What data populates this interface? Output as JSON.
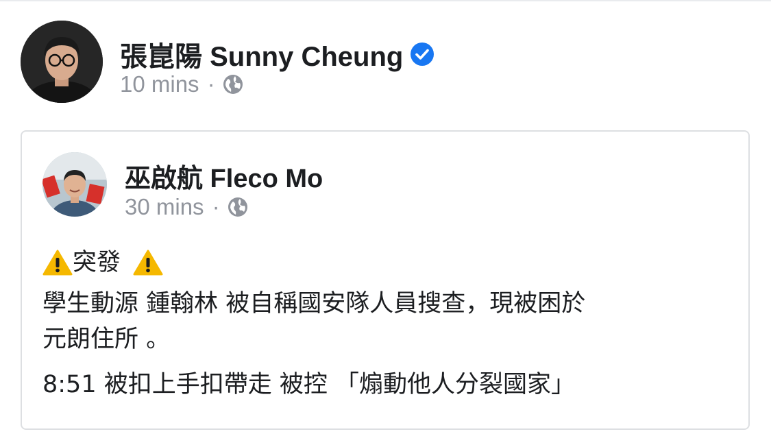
{
  "post": {
    "author": "張崑陽 Sunny Cheung",
    "verified_icon": "verified-check-icon",
    "time": "10 mins",
    "separator": "·",
    "audience_icon": "globe-icon"
  },
  "shared_post": {
    "author": "巫啟航 Fleco Mo",
    "time": "30 mins",
    "separator": "·",
    "audience_icon": "globe-icon",
    "headline": "突發",
    "headline_icon": "warning-icon",
    "line1": "學生動源 鍾翰林 被自稱國安隊人員搜查，現被困於",
    "line2": "元朗住所 。",
    "line3": "8:51 被扣上手扣帶走 被控 「煽動他人分裂國家」"
  },
  "colors": {
    "text": "#1c1e21",
    "meta": "#90949c",
    "verified": "#1877f2",
    "border": "#dddfe2",
    "warning": "#f5b800"
  }
}
